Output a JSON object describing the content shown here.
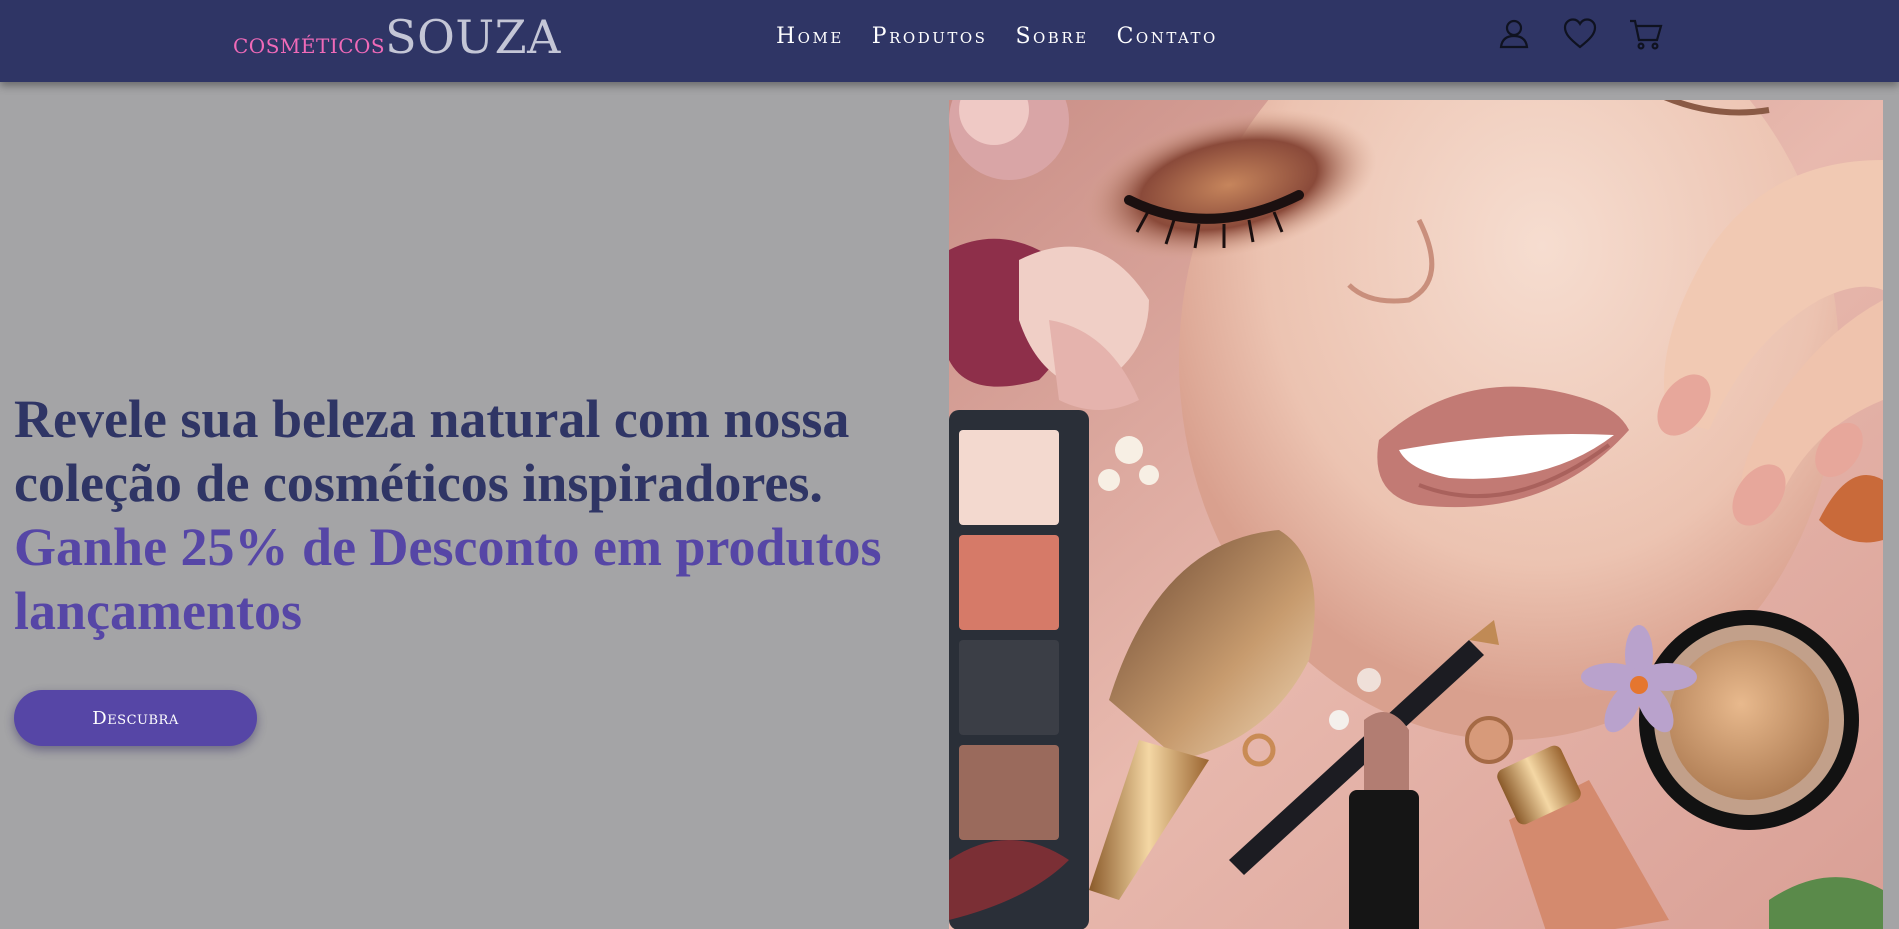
{
  "brand": {
    "name_prefix": "cosméticos",
    "name_main": "SOUZA",
    "colors": {
      "header_bg": "#2f3565",
      "page_bg": "#a4a4a6",
      "accent": "#5646a6",
      "logo_pink": "#f06ab8"
    }
  },
  "nav": {
    "items": [
      {
        "label": "Home"
      },
      {
        "label": "Produtos"
      },
      {
        "label": "Sobre"
      },
      {
        "label": "Contato"
      }
    ]
  },
  "header_icons": [
    {
      "name": "user-icon"
    },
    {
      "name": "heart-icon"
    },
    {
      "name": "cart-icon"
    }
  ],
  "hero": {
    "headline_line": "Revele sua beleza natural com nossa coleção de cosméticos inspiradores.",
    "offer_line": "Ganhe 25% de Desconto em produtos lançamentos",
    "cta_label": "Descubra"
  }
}
